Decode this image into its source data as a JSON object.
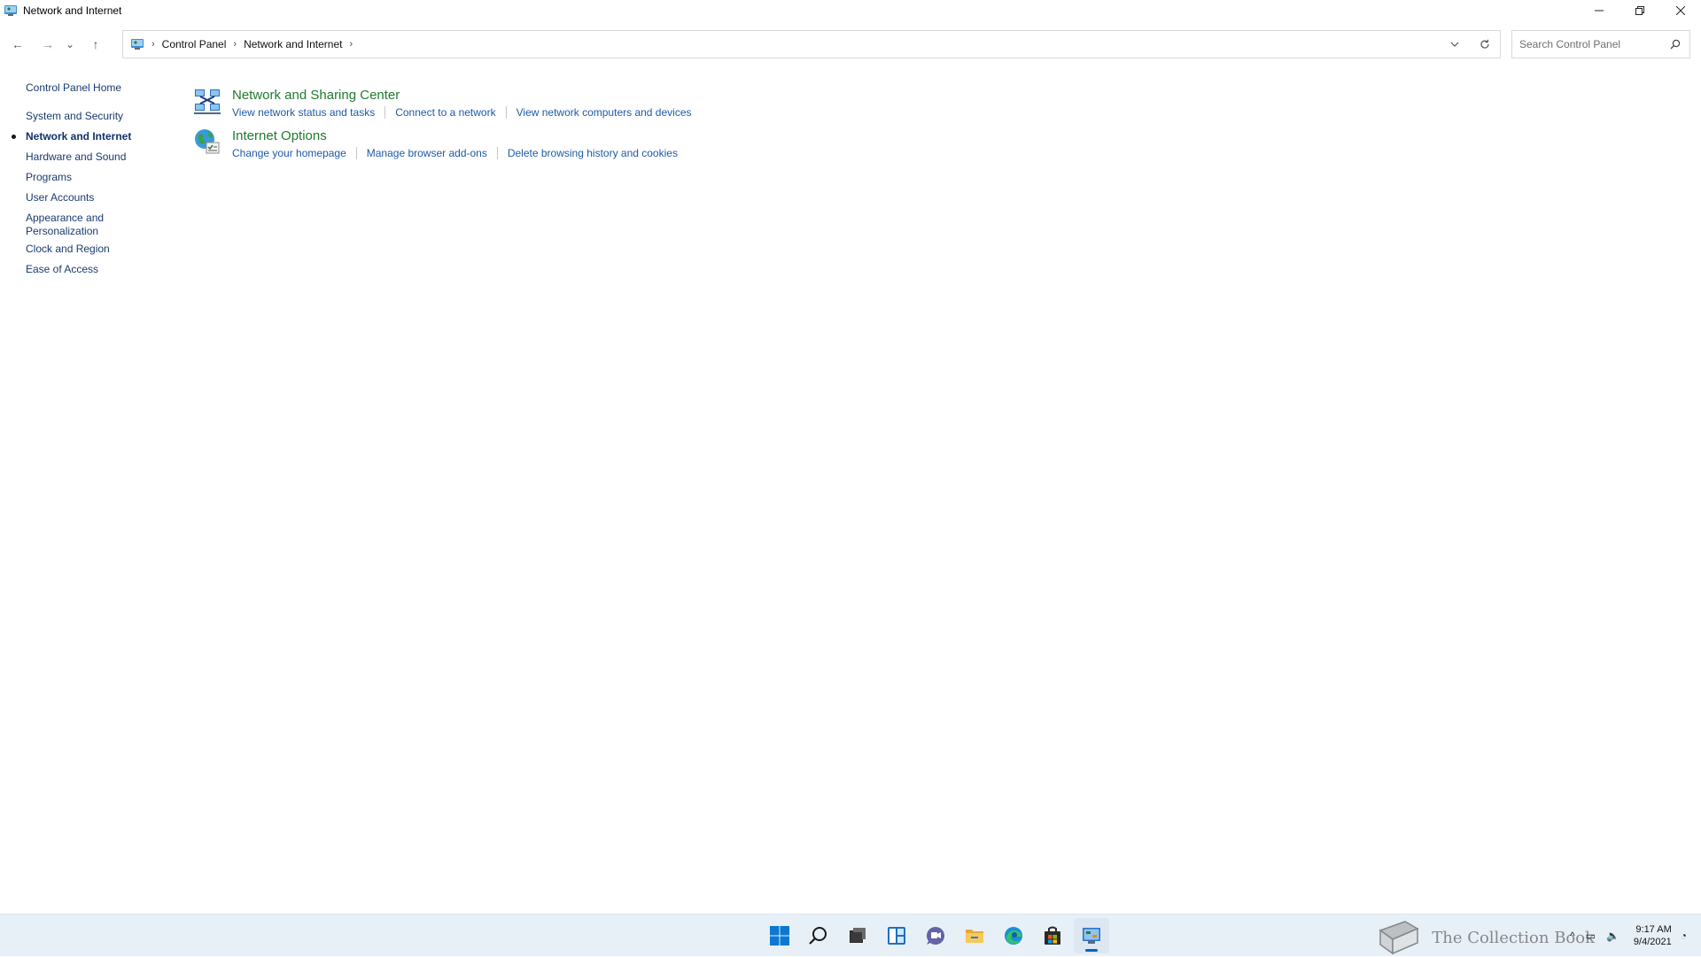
{
  "window": {
    "title": "Network and Internet",
    "controls": {
      "minimize": "—",
      "maximize": "❐",
      "close": "✕"
    }
  },
  "nav": {
    "back": "←",
    "forward": "→",
    "recent": "⌄",
    "up": "↑",
    "breadcrumb": [
      "Control Panel",
      "Network and Internet"
    ],
    "separator": "›",
    "search_placeholder": "Search Control Panel"
  },
  "left_pane": {
    "home": "Control Panel Home",
    "items": [
      {
        "label": "System and Security",
        "active": false
      },
      {
        "label": "Network and Internet",
        "active": true
      },
      {
        "label": "Hardware and Sound",
        "active": false
      },
      {
        "label": "Programs",
        "active": false
      },
      {
        "label": "User Accounts",
        "active": false
      },
      {
        "label": "Appearance and\nPersonalization",
        "active": false
      },
      {
        "label": "Clock and Region",
        "active": false
      },
      {
        "label": "Ease of Access",
        "active": false
      }
    ]
  },
  "categories": [
    {
      "title": "Network and Sharing Center",
      "icon": "network-sharing-icon",
      "links": [
        "View network status and tasks",
        "Connect to a network",
        "View network computers and devices"
      ]
    },
    {
      "title": "Internet Options",
      "icon": "internet-options-icon",
      "links": [
        "Change your homepage",
        "Manage browser add-ons",
        "Delete browsing history and cookies"
      ]
    }
  ],
  "taskbar": {
    "apps": [
      "start-icon",
      "search-icon",
      "task-view-icon",
      "widgets-icon",
      "chat-icon",
      "file-explorer-icon",
      "edge-icon",
      "store-icon",
      "control-panel-icon"
    ],
    "active_app": "control-panel-icon",
    "watermark": "The Collection Book",
    "tray": {
      "chevron": "^",
      "network": "▭",
      "volume": "🔈",
      "focus": "◔"
    },
    "time": "9:17 AM",
    "date": "9/4/2021"
  },
  "colors": {
    "link": "#1d5aa8",
    "category_title": "#1e7b2e",
    "left_pane_text": "#1a3a6e",
    "taskbar_bg": "#e8f0f7",
    "accent": "#0067c0"
  }
}
